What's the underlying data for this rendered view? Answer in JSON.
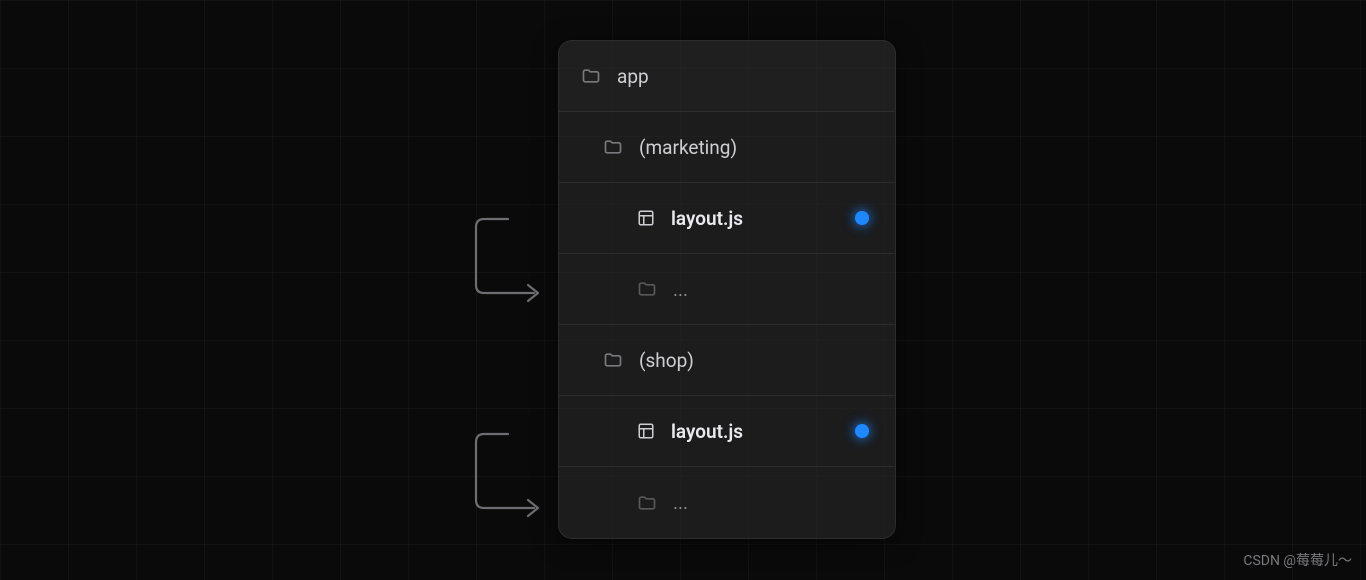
{
  "tree": {
    "root": {
      "label": "app",
      "type": "folder"
    },
    "group1": {
      "label": "(marketing)",
      "type": "folder"
    },
    "file1": {
      "label": "layout.js",
      "type": "layout",
      "highlighted": true
    },
    "more1": {
      "label": "...",
      "type": "folder-muted"
    },
    "group2": {
      "label": "(shop)",
      "type": "folder"
    },
    "file2": {
      "label": "layout.js",
      "type": "layout",
      "highlighted": true
    },
    "more2": {
      "label": "...",
      "type": "folder-muted"
    }
  },
  "watermark": "CSDN @莓莓儿～"
}
